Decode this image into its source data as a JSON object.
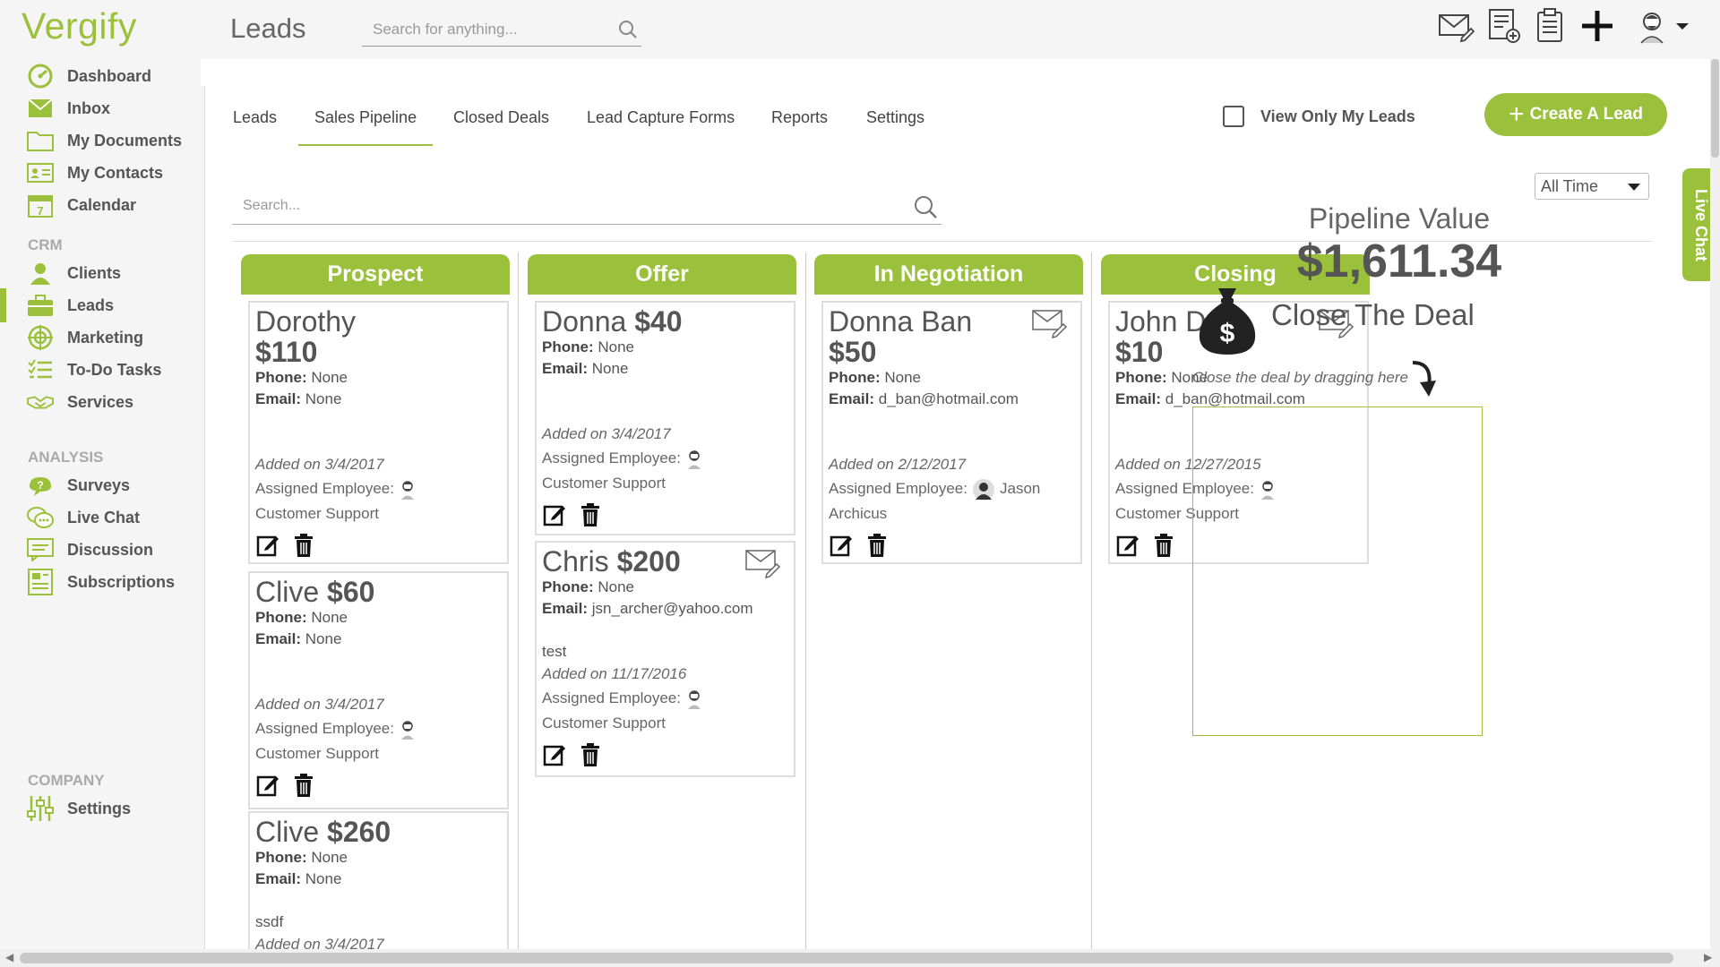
{
  "app": {
    "logo": "Vergify",
    "page_title": "Leads",
    "search_placeholder": "Search for anything..."
  },
  "top_icons": [
    "compose-mail-icon",
    "new-document-icon",
    "clipboard-icon",
    "plus-icon",
    "user-avatar-icon"
  ],
  "sidebar": {
    "items": [
      {
        "label": "Dashboard",
        "icon": "dashboard-icon"
      },
      {
        "label": "Inbox",
        "icon": "inbox-icon"
      },
      {
        "label": "My Documents",
        "icon": "folder-icon"
      },
      {
        "label": "My Contacts",
        "icon": "contacts-icon"
      },
      {
        "label": "Calendar",
        "icon": "calendar-icon"
      }
    ],
    "crm_label": "CRM",
    "crm_items": [
      {
        "label": "Clients",
        "icon": "client-icon"
      },
      {
        "label": "Leads",
        "icon": "briefcase-icon"
      },
      {
        "label": "Marketing",
        "icon": "target-icon"
      },
      {
        "label": "To-Do Tasks",
        "icon": "checklist-icon"
      },
      {
        "label": "Services",
        "icon": "handshake-icon"
      }
    ],
    "analysis_label": "ANALYSIS",
    "analysis_items": [
      {
        "label": "Surveys",
        "icon": "survey-icon"
      },
      {
        "label": "Live Chat",
        "icon": "chat-icon"
      },
      {
        "label": "Discussion",
        "icon": "discussion-icon"
      },
      {
        "label": "Subscriptions",
        "icon": "subscriptions-icon"
      }
    ],
    "company_label": "COMPANY",
    "company_items": [
      {
        "label": "Settings",
        "icon": "sliders-icon"
      }
    ]
  },
  "tabs": [
    "Leads",
    "Sales Pipeline",
    "Closed Deals",
    "Lead Capture Forms",
    "Reports",
    "Settings"
  ],
  "view_only_label": "View Only My Leads",
  "create_button": "Create A Lead",
  "time_filter": "All Time",
  "board_search_placeholder": "Search...",
  "stages": [
    "Prospect",
    "Offer",
    "In Negotiation",
    "Closing"
  ],
  "labels": {
    "phone": "Phone:",
    "email": "Email:",
    "assigned": "Assigned Employee:"
  },
  "cards": {
    "prospect": [
      {
        "name": "Dorothy",
        "amount": "$110",
        "phone": "None",
        "email": "None",
        "note": "",
        "added": "Added on 3/4/2017",
        "employee": "Customer Support"
      },
      {
        "name": "Clive",
        "amount": "$60",
        "phone": "None",
        "email": "None",
        "note": "",
        "added": "Added on 3/4/2017",
        "employee": "Customer Support"
      },
      {
        "name": "Clive",
        "amount": "$260",
        "phone": "None",
        "email": "None",
        "note": "ssdf",
        "added": "Added on 3/4/2017",
        "employee": ""
      }
    ],
    "offer": [
      {
        "name": "Donna",
        "amount": "$40",
        "phone": "None",
        "email": "None",
        "note": "",
        "added": "Added on 3/4/2017",
        "employee": "Customer Support"
      },
      {
        "name": "Chris",
        "amount": "$200",
        "phone": "None",
        "email": "jsn_archer@yahoo.com",
        "note": "test",
        "added": "Added on 11/17/2016",
        "employee": "Customer Support"
      }
    ],
    "negotiation": [
      {
        "name": "Donna Ban",
        "amount": "$50",
        "phone": "None",
        "email": "d_ban@hotmail.com",
        "note": "",
        "added": "Added on 2/12/2017",
        "employee_first": "Jason",
        "employee": "Archicus"
      }
    ],
    "closing": [
      {
        "name": "John Doe",
        "amount": "$10",
        "phone": "None",
        "email": "d_ban@hotmail.com",
        "note": "",
        "added": "Added on 12/27/2015",
        "employee": "Customer Support"
      }
    ]
  },
  "pipeline": {
    "title": "Pipeline Value",
    "value": "$1,611.34",
    "close_label": "Close The Deal",
    "drag_hint": "Close the deal by dragging here"
  },
  "live_chat": "Live Chat",
  "colors": {
    "brand": "#9bc03b",
    "text": "#555555"
  }
}
